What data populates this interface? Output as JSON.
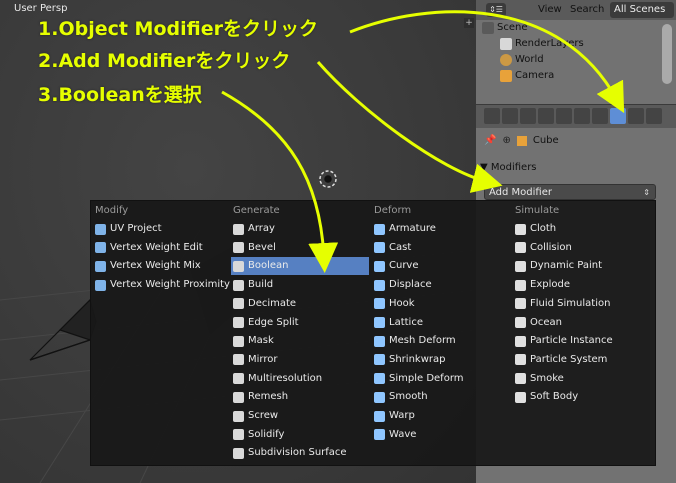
{
  "viewport": {
    "label": "User Persp",
    "plus": "+"
  },
  "outliner": {
    "header_btn": "⇕☰",
    "view_label": "View",
    "search_label": "Search",
    "scenes_select": "All Scenes",
    "rows": [
      {
        "label": "Scene"
      },
      {
        "label": "RenderLayers"
      },
      {
        "label": "World"
      },
      {
        "label": "Camera"
      }
    ]
  },
  "properties": {
    "context_object": "Cube",
    "modifiers_label": "Modifiers",
    "add_modifier_label": "Add Modifier"
  },
  "menu": {
    "columns": [
      {
        "header": "Modify",
        "items": [
          "UV Project",
          "Vertex Weight Edit",
          "Vertex Weight Mix",
          "Vertex Weight Proximity"
        ]
      },
      {
        "header": "Generate",
        "items": [
          "Array",
          "Bevel",
          "Boolean",
          "Build",
          "Decimate",
          "Edge Split",
          "Mask",
          "Mirror",
          "Multiresolution",
          "Remesh",
          "Screw",
          "Solidify",
          "Subdivision Surface"
        ]
      },
      {
        "header": "Deform",
        "items": [
          "Armature",
          "Cast",
          "Curve",
          "Displace",
          "Hook",
          "Lattice",
          "Mesh Deform",
          "Shrinkwrap",
          "Simple Deform",
          "Smooth",
          "Warp",
          "Wave"
        ]
      },
      {
        "header": "Simulate",
        "items": [
          "Cloth",
          "Collision",
          "Dynamic Paint",
          "Explode",
          "Fluid Simulation",
          "Ocean",
          "Particle Instance",
          "Particle System",
          "Smoke",
          "Soft Body"
        ]
      }
    ],
    "selected": "Boolean"
  },
  "annotations": {
    "step1": "1.Object Modifierをクリック",
    "step2": "2.Add Modifierをクリック",
    "step3": "3.Booleanを選択",
    "color": "#e6ff00"
  },
  "colors": {
    "accent": "#5680c2",
    "active_tab": "#5e8ed6",
    "menu_bg": "#181818",
    "panel_bg": "#727272"
  }
}
